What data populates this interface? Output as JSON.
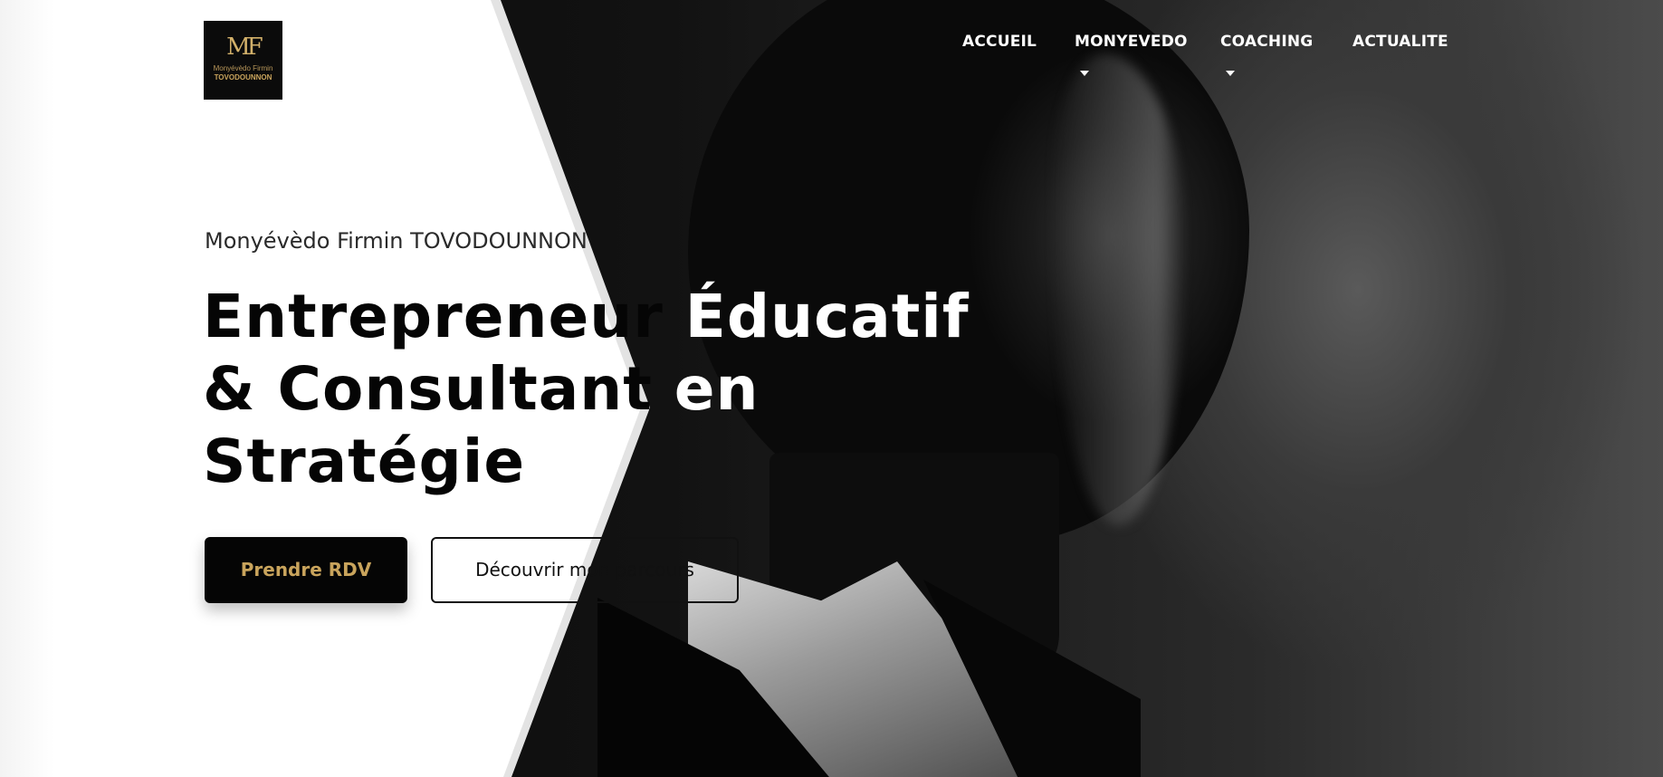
{
  "logo": {
    "mark": "MF",
    "line1": "Monyévèdo Firmin",
    "line2": "TOVODOUNNON"
  },
  "nav": {
    "items": [
      {
        "label": "ACCUEIL",
        "dropdown": false
      },
      {
        "label": "MONYEVEDO",
        "dropdown": true
      },
      {
        "label": "COACHING",
        "dropdown": true
      },
      {
        "label": "ACTUALITE",
        "dropdown": false
      }
    ]
  },
  "hero": {
    "subtitle": "Monyévèdo Firmin TOVODOUNNON",
    "headline": {
      "line1_dark": "Entrepreneur ",
      "line1_light": "Éducatif",
      "line2_dark": "& Consultant ",
      "line2_light": "en",
      "line3_dark": "Stratégie"
    },
    "primary_button": "Prendre RDV",
    "secondary_button": "Découvrir mon parcours"
  },
  "colors": {
    "accent_gold": "#c9a45c",
    "dark": "#050505",
    "light": "#ffffff"
  }
}
